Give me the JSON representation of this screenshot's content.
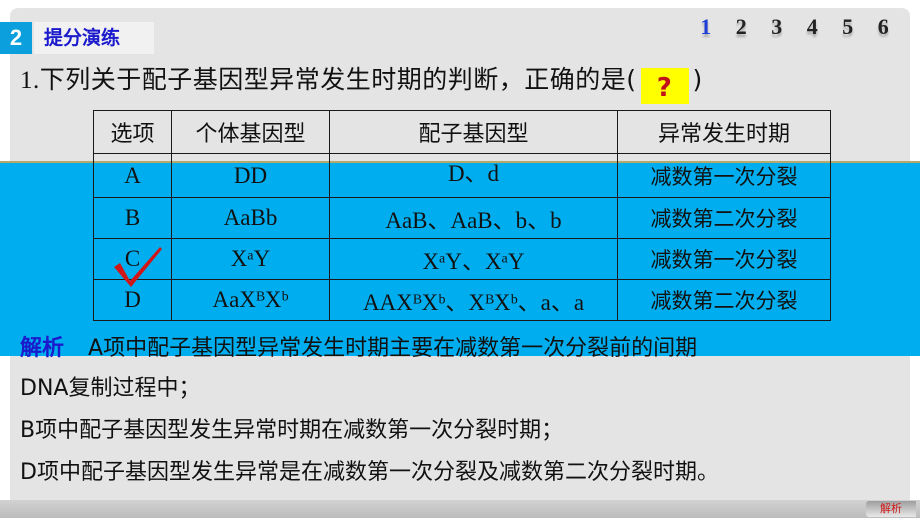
{
  "section": {
    "number": "2",
    "title": "提分演练"
  },
  "pager": {
    "pages": [
      "1",
      "2",
      "3",
      "4",
      "5",
      "6"
    ],
    "active_index": 0,
    "accent": "#1f3fd6"
  },
  "question": {
    "number": "1.",
    "text": "下列关于配子基因型异常发生时期的判断，正确的是(",
    "answer_placeholder": "?",
    "close": ")"
  },
  "table": {
    "headers": [
      "选项",
      "个体基因型",
      "配子基因型",
      "异常发生时期"
    ],
    "rows": [
      {
        "option": "A",
        "individual": "DD",
        "gametes": "D、d",
        "period": "减数第一次分裂"
      },
      {
        "option": "B",
        "individual": "AaBb",
        "gametes": "AaB、AaB、b、b",
        "period": "减数第二次分裂"
      },
      {
        "option": "C",
        "individual": "XᵃY",
        "gametes": "XᵃY、XᵃY",
        "period": "减数第一次分裂",
        "correct": true
      },
      {
        "option": "D",
        "individual": "AaXᴮXᵇ",
        "gametes": "AAXᴮXᵇ、XᴮXᵇ、a、a",
        "period": "减数第二次分裂"
      }
    ]
  },
  "explanation": {
    "label": "解析",
    "lines": [
      "A项中配子基因型异常发生时期主要在减数第一次分裂前的间期",
      "DNA复制过程中；",
      "B项中配子基因型发生异常时期在减数第一次分裂时期；",
      "D项中配子基因型发生异常是在减数第一次分裂及减数第二次分裂时期。"
    ]
  },
  "footer": {
    "analysis_button": "解析"
  },
  "colors": {
    "band": "#00aeef",
    "section_badge": "#0b9fde",
    "title_blue": "#1a1acc",
    "answer_bg": "#ffff00",
    "answer_fg": "#c0121b",
    "check": "#d01616"
  }
}
